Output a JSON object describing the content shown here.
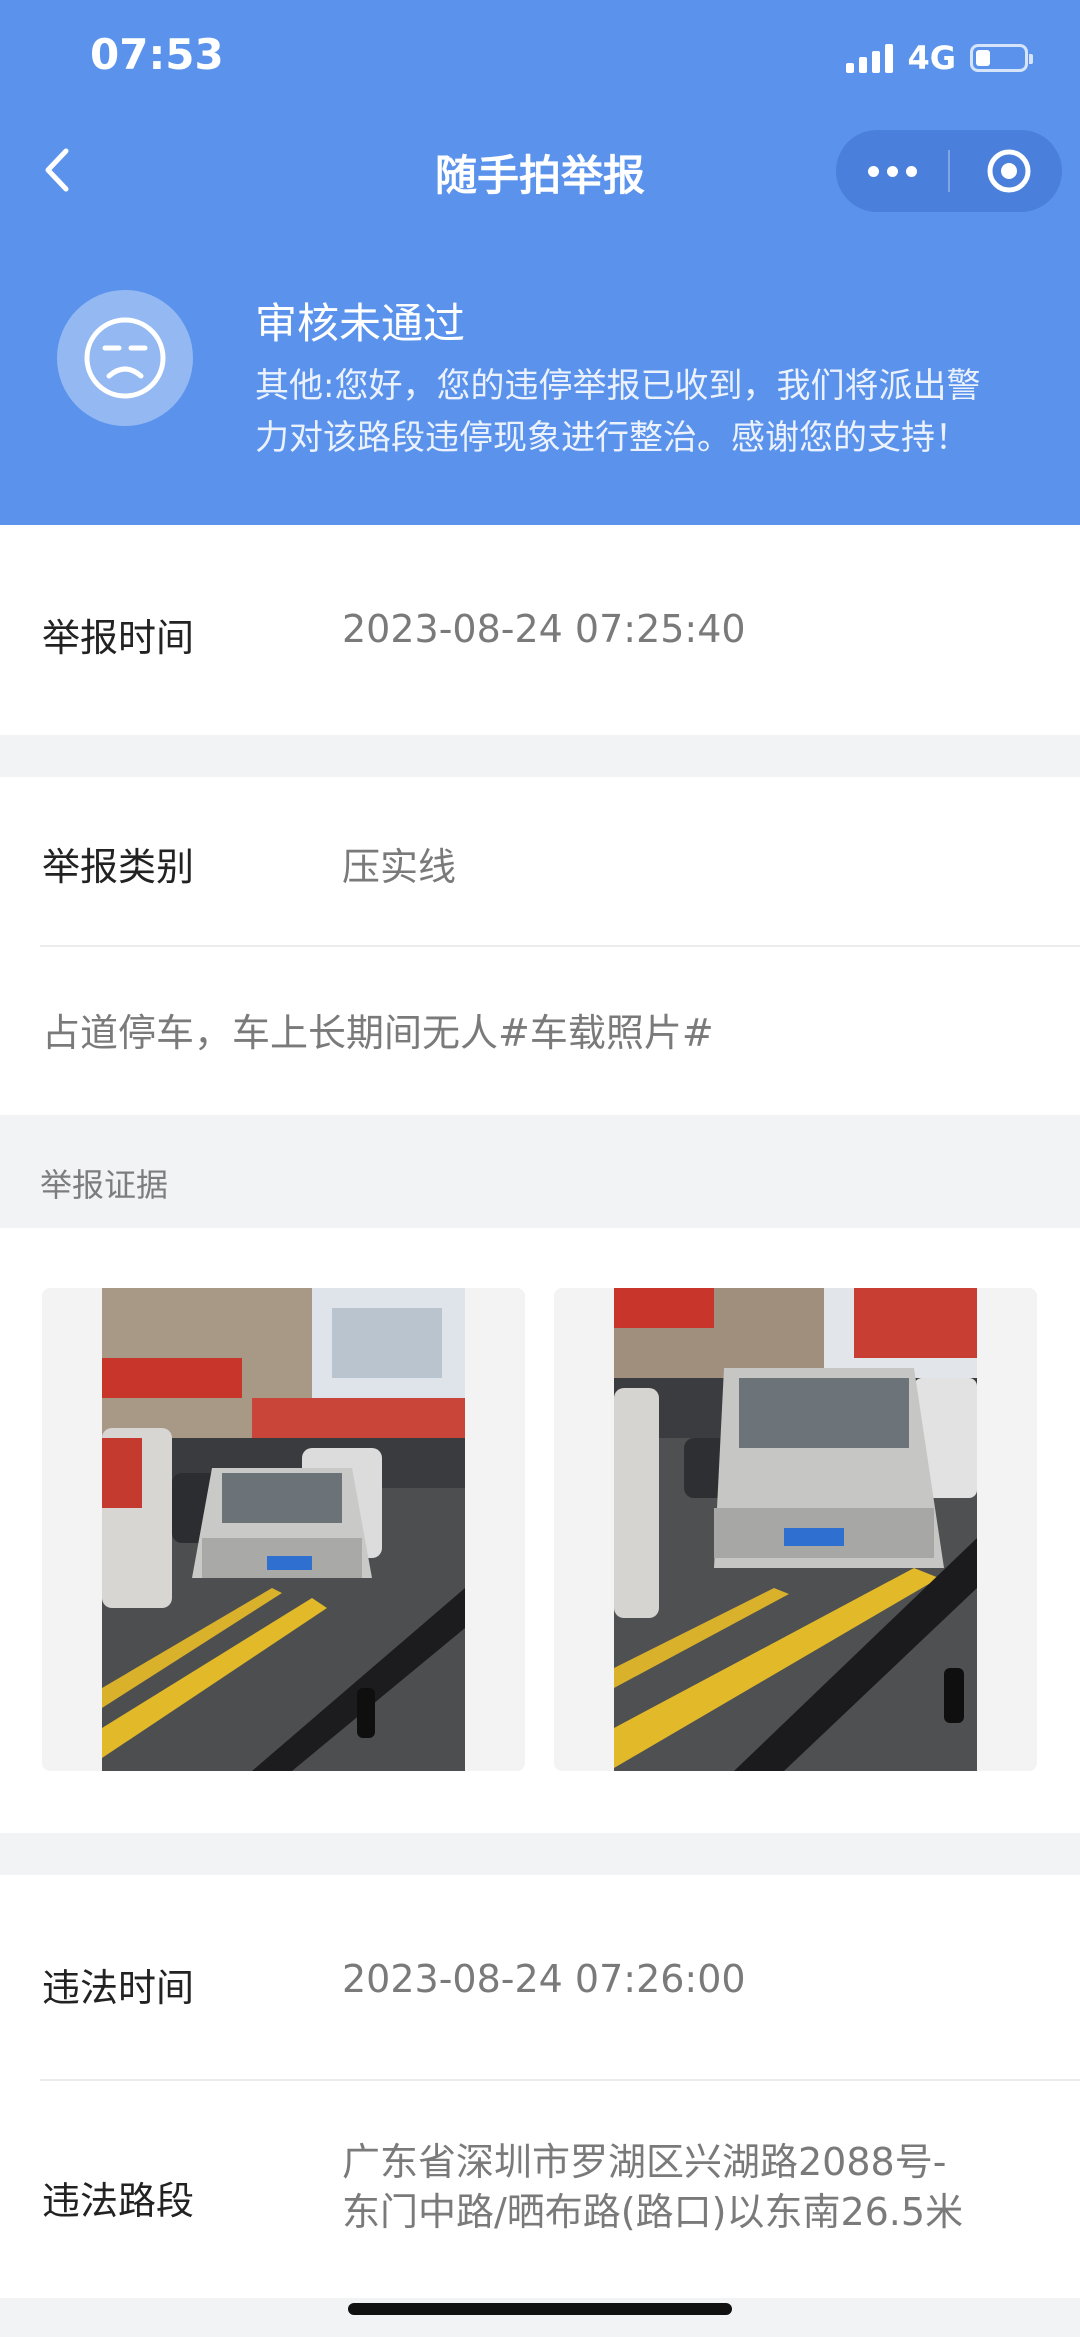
{
  "status_bar": {
    "time": "07:53",
    "network": "4G"
  },
  "nav": {
    "title": "随手拍举报",
    "back_icon": "chevron-left-icon",
    "more_icon": "more-dots-icon",
    "close_icon": "target-circle-icon"
  },
  "review": {
    "title": "审核未通过",
    "desc_line1": "其他:您好，您的违停举报已收到，我们将派出警",
    "desc_line2": "力对该路段违停现象进行整治。感谢您的支持！",
    "icon": "sad-face-icon"
  },
  "report_time": {
    "label": "举报时间",
    "value": "2023-08-24 07:25:40"
  },
  "report_type": {
    "label": "举报类别",
    "value": "压实线"
  },
  "description": "占道停车，车上长期间无人#车载照片#",
  "evidence": {
    "label": "举报证据",
    "photos": [
      "photo-1",
      "photo-2"
    ]
  },
  "violation_time": {
    "label": "违法时间",
    "value": "2023-08-24 07:26:00"
  },
  "violation_road": {
    "label": "违法路段",
    "value_line1": "广东省深圳市罗湖区兴湖路2088号-",
    "value_line2": "东门中路/晒布路(路口)以东南26.5米"
  },
  "colors": {
    "header": "#5b93ec",
    "capsule": "#4a80db",
    "road_line": "#e2b928"
  }
}
